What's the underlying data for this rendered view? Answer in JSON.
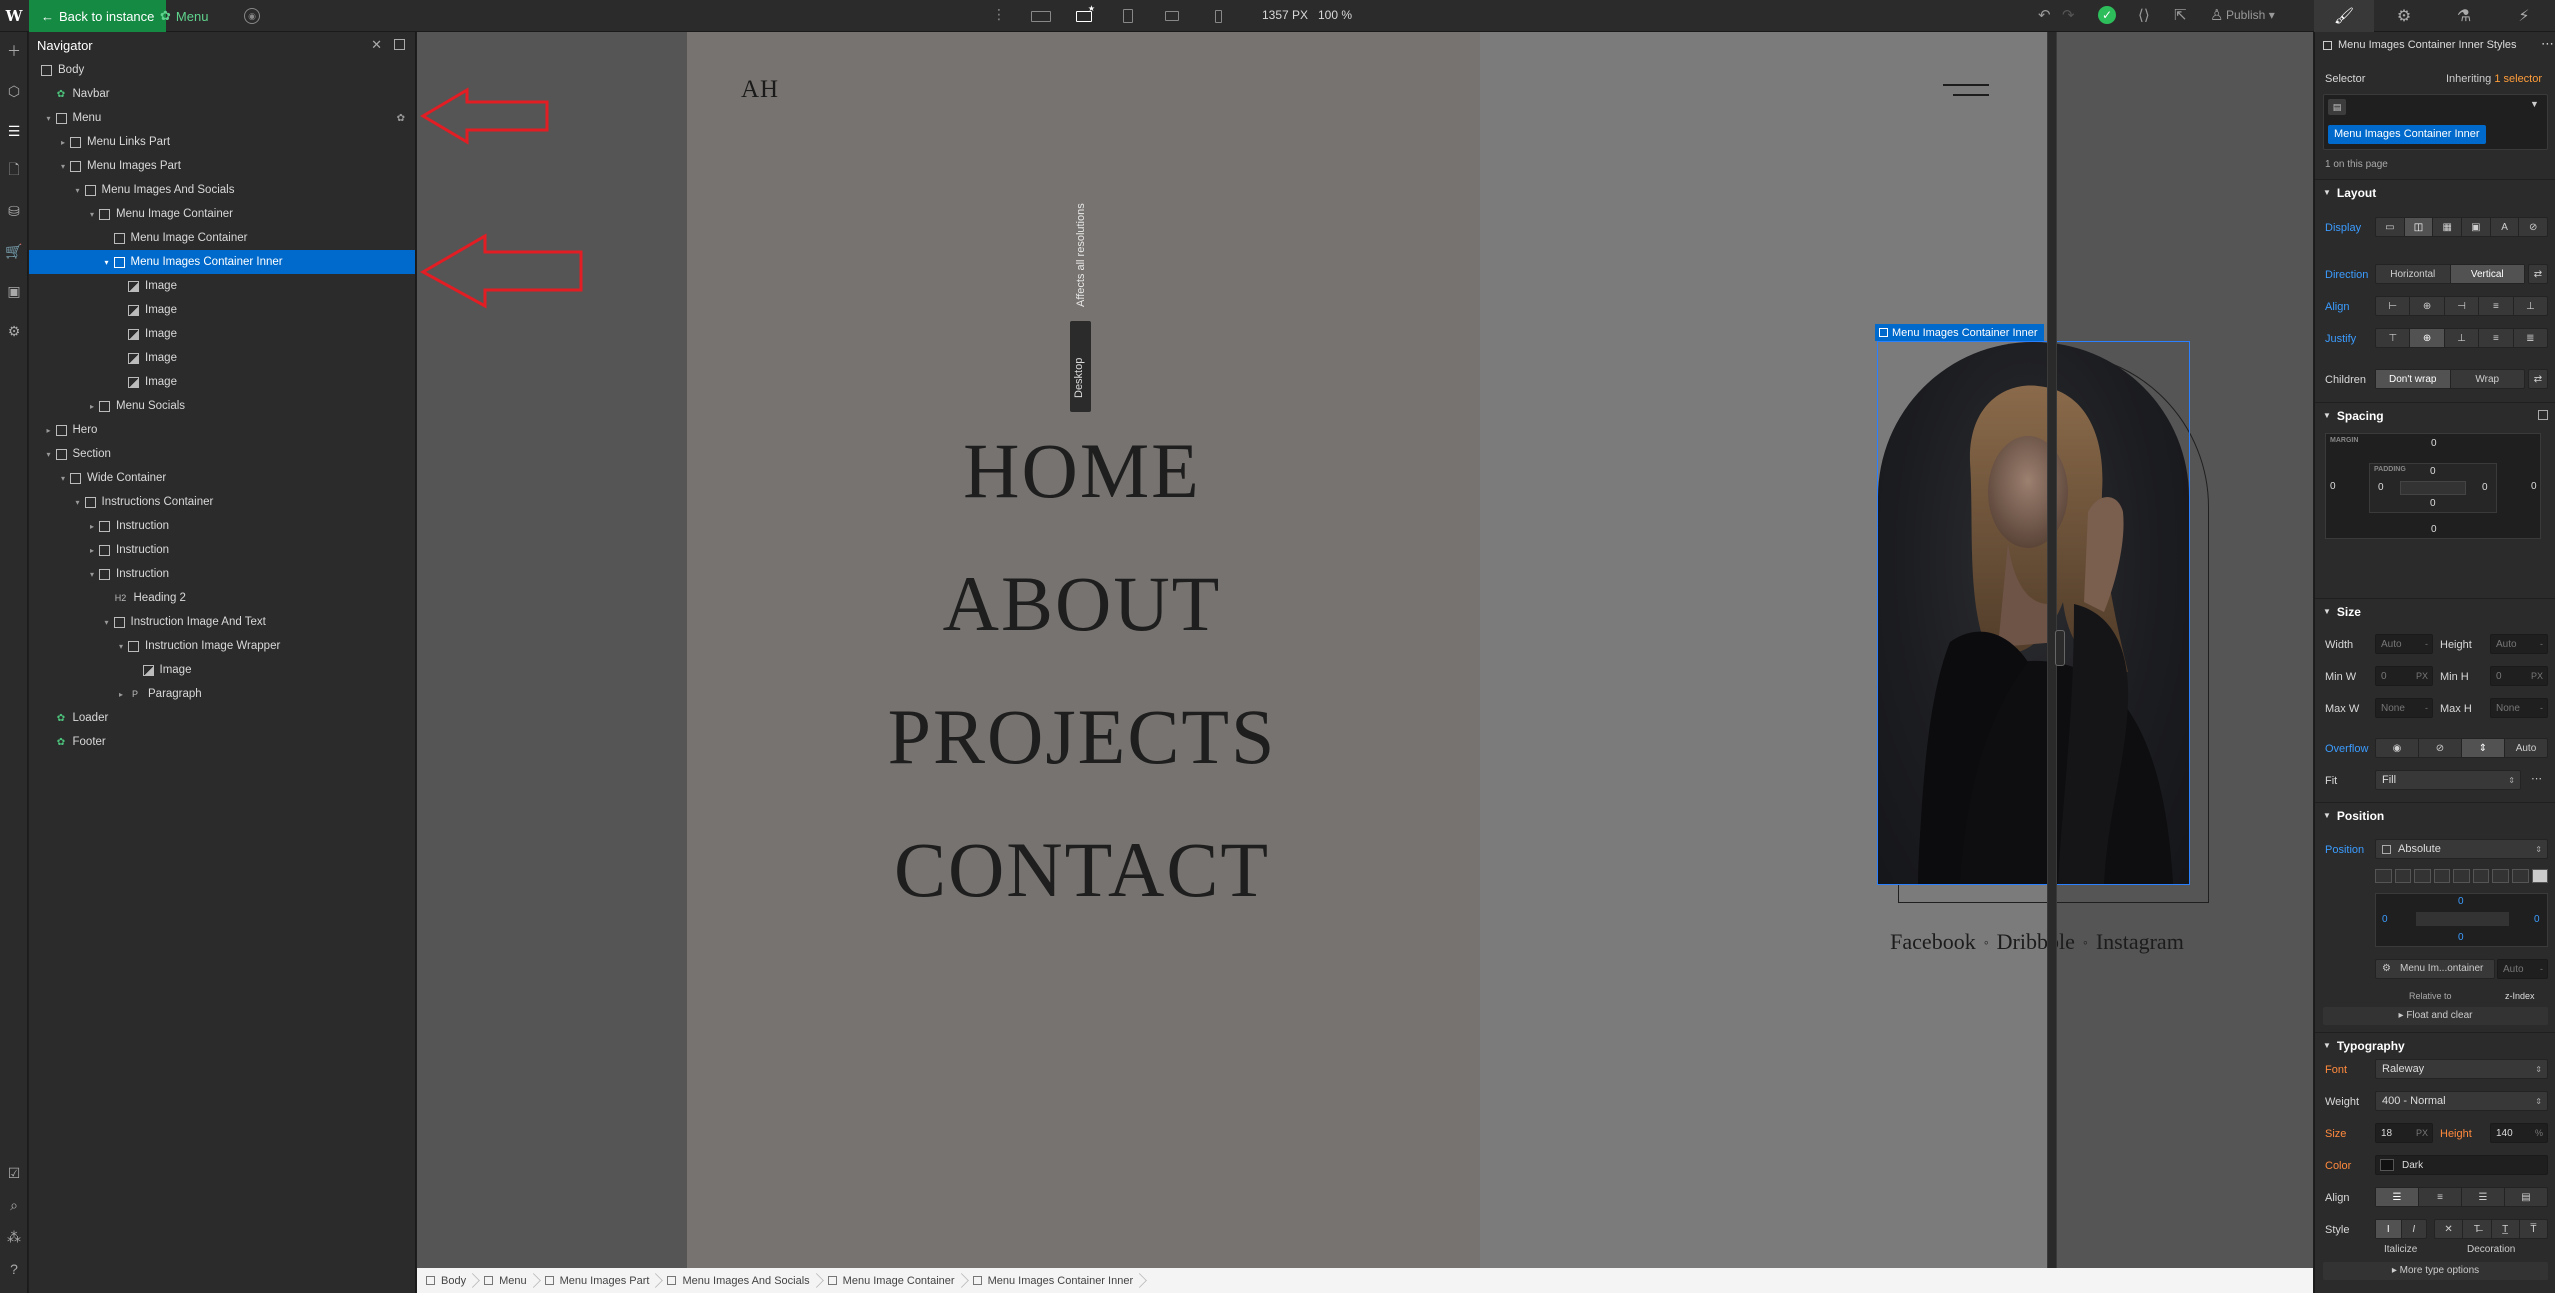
{
  "topbar": {
    "back_label": "Back to instance",
    "menu_label": "Menu",
    "canvas_width": "1357 PX",
    "zoom": "100 %",
    "publish_label": "Publish"
  },
  "navigator": {
    "title": "Navigator",
    "items": [
      {
        "label": "Body",
        "indent": 0,
        "caret": "",
        "icon": "box"
      },
      {
        "label": "Navbar",
        "indent": 1,
        "caret": "",
        "icon": "comp"
      },
      {
        "label": "Menu",
        "indent": 1,
        "caret": "▾",
        "icon": "box",
        "badge": true
      },
      {
        "label": "Menu Links Part",
        "indent": 2,
        "caret": "▸",
        "icon": "box"
      },
      {
        "label": "Menu Images Part",
        "indent": 2,
        "caret": "▾",
        "icon": "box"
      },
      {
        "label": "Menu Images And Socials",
        "indent": 3,
        "caret": "▾",
        "icon": "box"
      },
      {
        "label": "Menu Image Container",
        "indent": 4,
        "caret": "▾",
        "icon": "box"
      },
      {
        "label": "Menu Image Container",
        "indent": 5,
        "caret": "",
        "icon": "box"
      },
      {
        "label": "Menu Images Container Inner",
        "indent": 5,
        "caret": "▾",
        "icon": "box",
        "selected": true
      },
      {
        "label": "Image",
        "indent": 6,
        "caret": "",
        "icon": "img"
      },
      {
        "label": "Image",
        "indent": 6,
        "caret": "",
        "icon": "img"
      },
      {
        "label": "Image",
        "indent": 6,
        "caret": "",
        "icon": "img"
      },
      {
        "label": "Image",
        "indent": 6,
        "caret": "",
        "icon": "img"
      },
      {
        "label": "Image",
        "indent": 6,
        "caret": "",
        "icon": "img"
      },
      {
        "label": "Menu Socials",
        "indent": 4,
        "caret": "▸",
        "icon": "box"
      },
      {
        "label": "Hero",
        "indent": 1,
        "caret": "▸",
        "icon": "box"
      },
      {
        "label": "Section",
        "indent": 1,
        "caret": "▾",
        "icon": "box"
      },
      {
        "label": "Wide Container",
        "indent": 2,
        "caret": "▾",
        "icon": "box"
      },
      {
        "label": "Instructions Container",
        "indent": 3,
        "caret": "▾",
        "icon": "box"
      },
      {
        "label": "Instruction",
        "indent": 4,
        "caret": "▸",
        "icon": "box"
      },
      {
        "label": "Instruction",
        "indent": 4,
        "caret": "▸",
        "icon": "box"
      },
      {
        "label": "Instruction",
        "indent": 4,
        "caret": "▾",
        "icon": "box"
      },
      {
        "label": "Heading 2",
        "indent": 5,
        "caret": "",
        "icon": "h2"
      },
      {
        "label": "Instruction Image And Text",
        "indent": 5,
        "caret": "▾",
        "icon": "box"
      },
      {
        "label": "Instruction Image Wrapper",
        "indent": 6,
        "caret": "▾",
        "icon": "box"
      },
      {
        "label": "Image",
        "indent": 7,
        "caret": "",
        "icon": "img"
      },
      {
        "label": "Paragraph",
        "indent": 6,
        "caret": "▸",
        "icon": "p"
      },
      {
        "label": "Loader",
        "indent": 1,
        "caret": "",
        "icon": "comp"
      },
      {
        "label": "Footer",
        "indent": 1,
        "caret": "",
        "icon": "comp"
      }
    ]
  },
  "canvas": {
    "affects_text": "Affects all resolutions",
    "desktop_label": "Desktop",
    "logo": "AH",
    "menu_links": [
      "HOME",
      "ABOUT",
      "PROJECTS",
      "CONTACT"
    ],
    "selected_label": "Menu Images Container Inner",
    "socials": [
      "Facebook",
      "Dribbble",
      "Instagram"
    ]
  },
  "breadcrumb": [
    "Body",
    "Menu",
    "Menu Images Part",
    "Menu Images And Socials",
    "Menu Image Container",
    "Menu Images Container Inner"
  ],
  "stylepanel": {
    "header": "Menu Images Container Inner Styles",
    "selector_label": "Selector",
    "inheriting_label": "Inheriting",
    "inheriting_count": "1 selector",
    "selector_chip": "Menu Images Container Inner",
    "on_page": "1 on this page",
    "layout": {
      "title": "Layout",
      "display_label": "Display",
      "direction_label": "Direction",
      "direction_options": [
        "Horizontal",
        "Vertical"
      ],
      "align_label": "Align",
      "justify_label": "Justify",
      "children_label": "Children",
      "children_options": [
        "Don't wrap",
        "Wrap"
      ]
    },
    "spacing": {
      "title": "Spacing",
      "margin_label": "MARGIN",
      "padding_label": "PADDING",
      "margin_top": "0",
      "margin_right": "0",
      "margin_bottom": "0",
      "margin_left": "0",
      "padding_top": "0",
      "padding_right": "0",
      "padding_bottom": "0",
      "padding_left": "0"
    },
    "size": {
      "title": "Size",
      "width_label": "Width",
      "width_value": "Auto",
      "height_label": "Height",
      "height_value": "Auto",
      "minw_label": "Min W",
      "minw_value": "0",
      "minw_unit": "PX",
      "minh_label": "Min H",
      "minh_value": "0",
      "minh_unit": "PX",
      "maxw_label": "Max W",
      "maxw_value": "None",
      "maxh_label": "Max H",
      "maxh_value": "None",
      "overflow_label": "Overflow",
      "overflow_auto": "Auto",
      "fit_label": "Fit",
      "fit_value": "Fill"
    },
    "position": {
      "title": "Position",
      "position_label": "Position",
      "position_value": "Absolute",
      "top": "0",
      "left": "0",
      "right": "0",
      "bottom": "0",
      "relative_target": "Menu Im...ontainer",
      "zindex_value": "Auto",
      "relative_to_label": "Relative to",
      "zindex_label": "z-Index",
      "float_label": "Float and clear"
    },
    "typography": {
      "title": "Typography",
      "font_label": "Font",
      "font_value": "Raleway",
      "weight_label": "Weight",
      "weight_value": "400 - Normal",
      "size_label": "Size",
      "size_value": "18",
      "size_unit": "PX",
      "height_label": "Height",
      "height_value": "140",
      "height_unit": "%",
      "color_label": "Color",
      "color_value": "Dark",
      "align_label": "Align",
      "style_label": "Style",
      "italicize_label": "Italicize",
      "decoration_label": "Decoration",
      "more_label": "More type options"
    }
  },
  "colors": {
    "accent_blue": "#006acc",
    "back_green": "#148a43",
    "arrow_red": "#e21d24",
    "canvas_bg": "#555555",
    "site_left": "#777370",
    "site_right": "#7b7b7b"
  }
}
